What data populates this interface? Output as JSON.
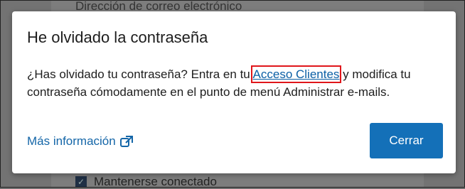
{
  "background": {
    "email_label": "Dirección de correo electrónico",
    "stay_connected_label": "Mantenerse conectado"
  },
  "modal": {
    "title": "He olvidado la contraseña",
    "body_before": "¿Has olvidado tu contraseña? Entra en tu ",
    "link_label": "Acceso Clientes",
    "body_after": " y modifica tu contraseña cómodamente en el punto de menú Administrar e-mails.",
    "more_info_label": "Más información",
    "more_info_icon": "external-link-icon",
    "close_label": "Cerrar"
  },
  "colors": {
    "accent": "#1470b8",
    "link": "#1466a8",
    "highlight": "#e0161b"
  }
}
